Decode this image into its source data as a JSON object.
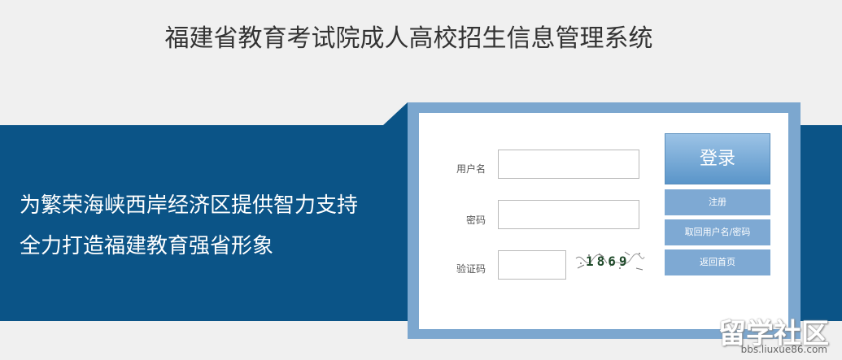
{
  "header": {
    "title": "福建省教育考试院成人高校招生信息管理系统"
  },
  "banner": {
    "slogan_line1": "为繁荣海峡西岸经济区提供智力支持",
    "slogan_line2": "全力打造福建教育强省形象"
  },
  "login_form": {
    "username_label": "用户名",
    "username_value": "",
    "password_label": "密码",
    "password_value": "",
    "captcha_label": "验证码",
    "captcha_value": "",
    "captcha_text": "1869"
  },
  "buttons": {
    "login": "登录",
    "register": "注册",
    "retrieve": "取回用户名/密码",
    "home": "返回首页"
  },
  "watermark": {
    "brand": "留学社区",
    "url": "bbs.liuxue86.com"
  },
  "colors": {
    "banner": "#0b5487",
    "panel_frame": "#7ca7cf",
    "button": "#7ea9d3"
  }
}
